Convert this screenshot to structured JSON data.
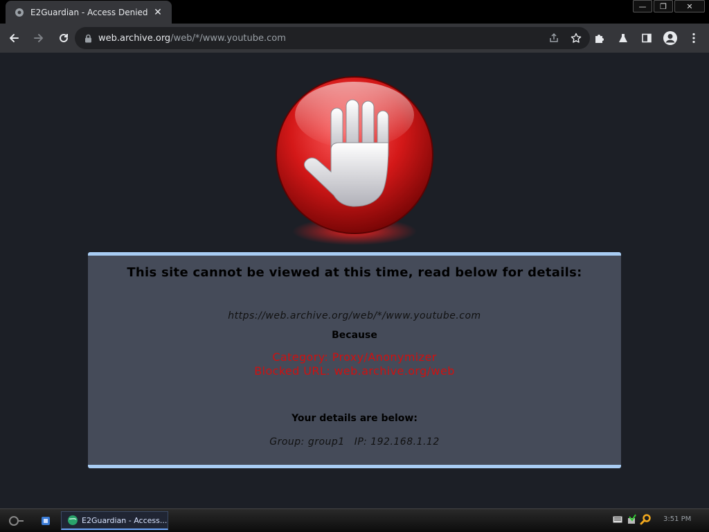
{
  "browser": {
    "tab_title": "E2Guardian - Access Denied",
    "tab_close": "✕",
    "url_host": "web.archive.org",
    "url_path": "/web/*/www.youtube.com",
    "window_controls": {
      "minimize": "—",
      "restore": "❐",
      "close": "✕"
    }
  },
  "page": {
    "heading": "This site cannot be viewed at this time, read below for details:",
    "blocked_url": "https://web.archive.org/web/*/www.youtube.com",
    "because": "Because",
    "category": "Category: Proxy/Anonymizer",
    "blocked_by": "Blocked URL: web.archive.org/web",
    "details_heading": "Your details are below:",
    "group": "Group: group1",
    "ip": "IP: 192.168.1.12"
  },
  "taskbar": {
    "task_label": "E2Guardian - Access...",
    "clock": "3:51 PM"
  },
  "colors": {
    "panel_bg": "#454b59",
    "panel_border": "#a9cdf4",
    "reason_red": "#d01010",
    "page_bg": "#1c1f26"
  },
  "icons": [
    "globe-icon",
    "close-icon",
    "back-icon",
    "forward-icon",
    "reload-icon",
    "lock-icon",
    "share-icon",
    "star-icon",
    "extensions-icon",
    "labs-icon",
    "sidepanel-icon",
    "profile-icon",
    "menu-icon",
    "stop-hand-icon"
  ]
}
